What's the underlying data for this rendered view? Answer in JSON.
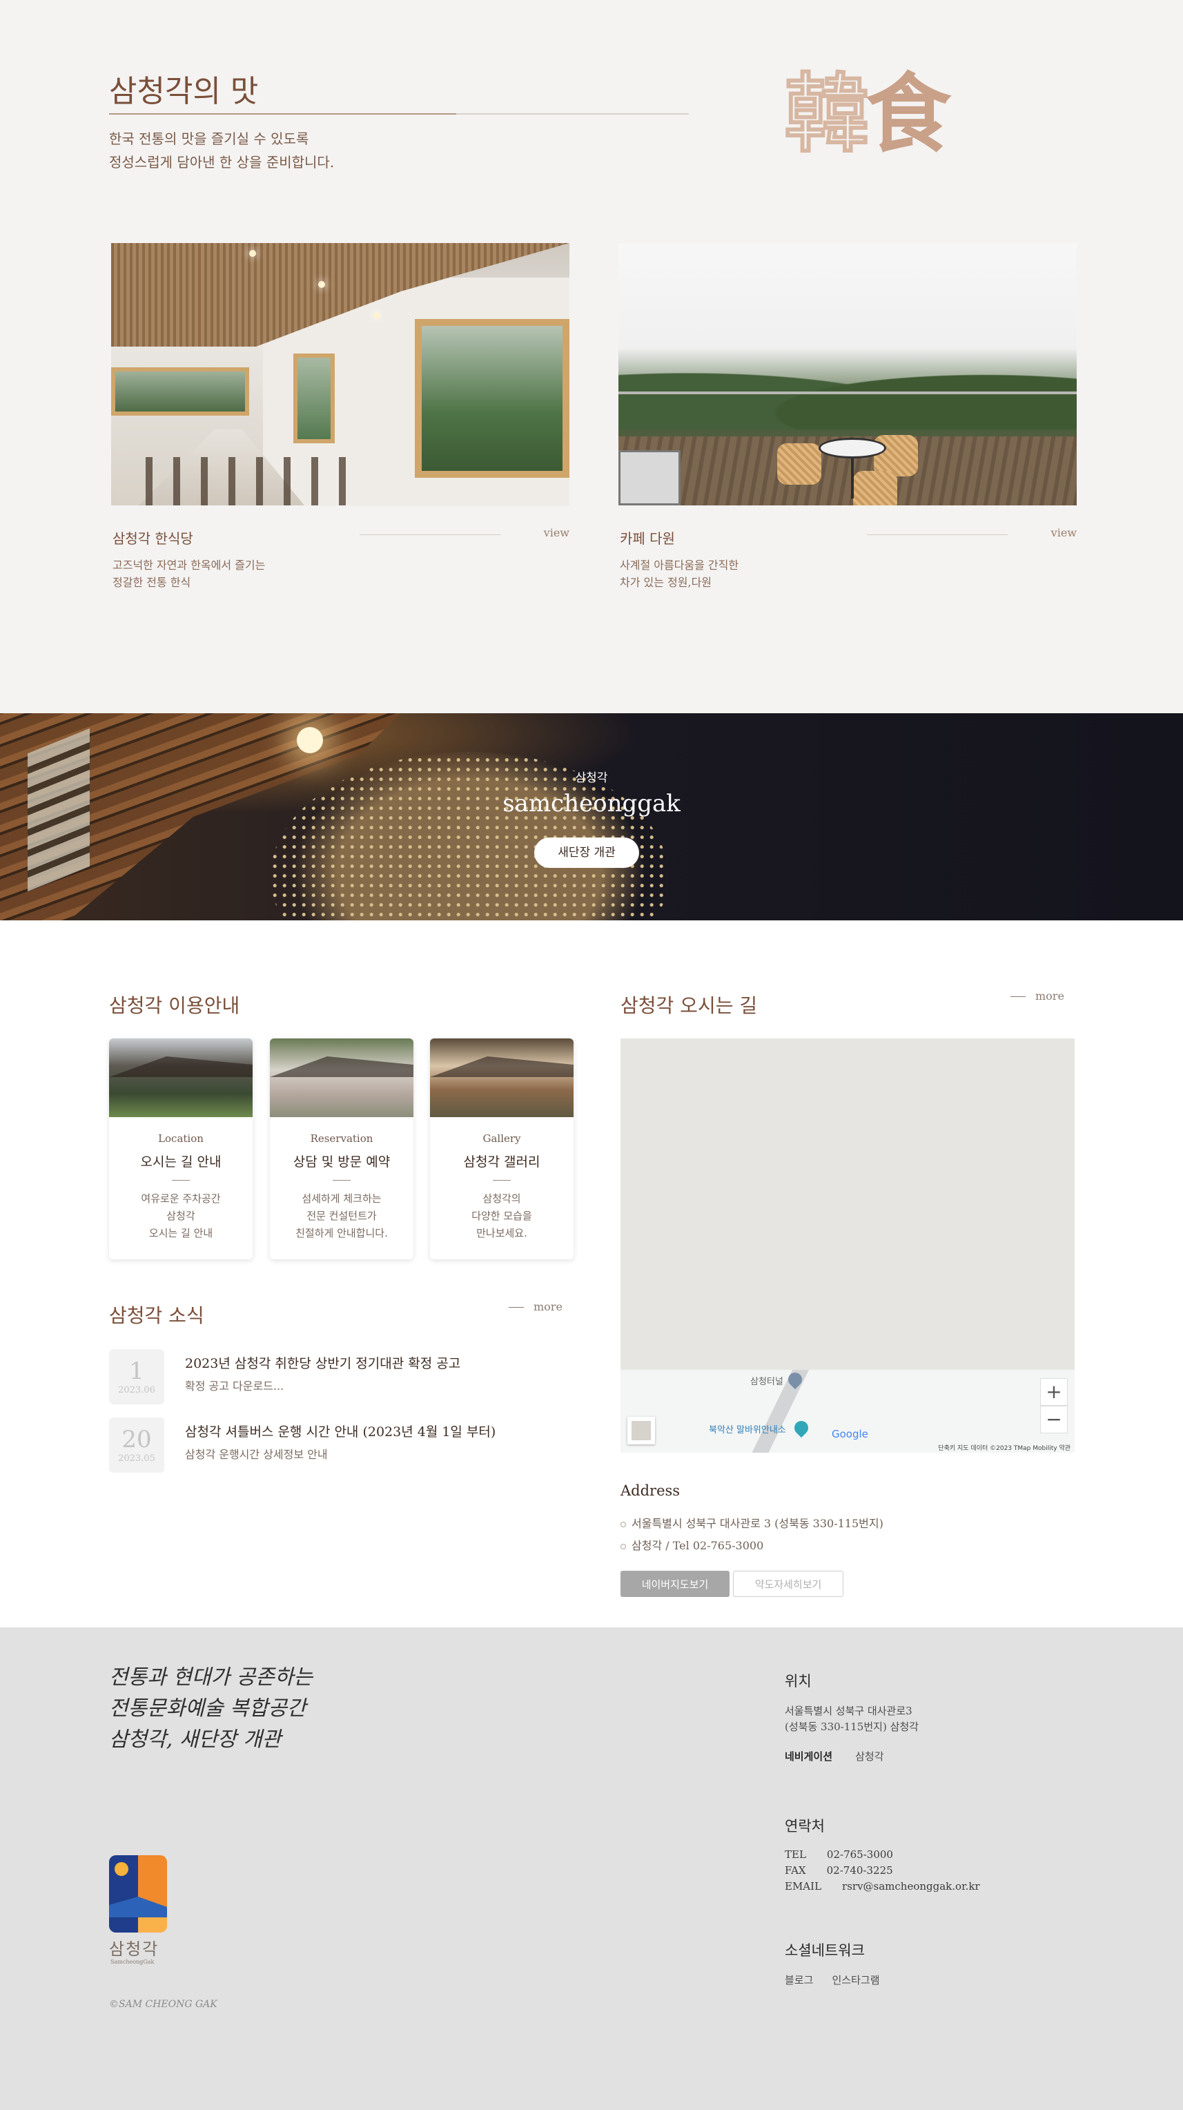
{
  "taste": {
    "title": "삼청각의 맛",
    "desc": "한국 전통의 맛을 즐기실 수 있도록\n정성스럽게 담아낸 한 상을 준비합니다.",
    "hanja_1": "韓",
    "hanja_2": "食",
    "cards": [
      {
        "title": "삼청각 한식당",
        "view": "view",
        "desc": "고즈넉한 자연과 한옥에서 즐기는\n정갈한 전통 한식"
      },
      {
        "title": "카페 다원",
        "view": "view",
        "desc": "사계절 아름다움을 간직한\n차가 있는 정원,다원"
      }
    ]
  },
  "banner": {
    "eyebrow": "삼청각",
    "title": "samcheonggak",
    "button": "새단장 개관"
  },
  "guide": {
    "title": "삼청각 이용안내",
    "cards": [
      {
        "en": "Location",
        "ko": "오시는 길 안내",
        "desc": "여유로운 주차공간\n삼청각\n오시는 길 안내"
      },
      {
        "en": "Reservation",
        "ko": "상담 및 방문 예약",
        "desc": "섬세하게 체크하는\n전문 컨설턴트가\n친절하게 안내합니다."
      },
      {
        "en": "Gallery",
        "ko": "삼청각 갤러리",
        "desc": "삼청각의\n다양한 모습을\n만나보세요."
      }
    ]
  },
  "news": {
    "title": "삼청각 소식",
    "more": "more",
    "items": [
      {
        "day": "1",
        "ym": "2023.06",
        "title": "2023년 삼청각 취한당 상반기 정기대관 확정 공고",
        "sub": "확정 공고 다운로드..."
      },
      {
        "day": "20",
        "ym": "2023.05",
        "title": "삼청각 셔틀버스 운행 시간 안내 (2023년 4월 1일 부터)",
        "sub": "삼청각 운행시간 상세정보 안내"
      }
    ]
  },
  "directions": {
    "title": "삼청각 오시는 길",
    "more": "more",
    "map": {
      "label_1": "삼청터널",
      "label_2": "북악산 말바위안내소",
      "google": "Google",
      "zoom_in": "+",
      "zoom_out": "−",
      "attribution": "단축키   지도 데이터 ©2023 TMap Mobility   약관"
    },
    "address_heading": "Address",
    "address_1": "서울특별시 성북구 대사관로 3 (성북동 330-115번지)",
    "address_2": "삼청각 / Tel 02-765-3000",
    "btn_naver": "네이버지도보기",
    "btn_detail": "약도자세히보기"
  },
  "footer": {
    "slogan": "전통과 현대가 공존하는\n전통문화예술 복합공간\n삼청각, 새단장 개관",
    "logo_name": "삼청각",
    "logo_sub": "SamcheongGak",
    "copyright": "©SAM CHEONG GAK",
    "location_h": "위치",
    "location_t": "서울특별시 성북구 대사관로3\n(성북동 330-115번지) 삼청각",
    "nav_label": "네비게이션",
    "nav_value": "삼청각",
    "contact_h": "연락처",
    "tel_k": "TEL",
    "tel_v": "02-765-3000",
    "fax_k": "FAX",
    "fax_v": "02-740-3225",
    "email_k": "EMAIL",
    "email_v": "rsrv@samcheonggak.or.kr",
    "social_h": "소셜네트워크",
    "social_1": "블로그",
    "social_2": "인스타그램"
  },
  "colors": {
    "accent_brown": "#7a4f3a",
    "bg_light": "#f4f3f2",
    "footer_bg": "#e1e1e1",
    "banner_dark": "#14141d"
  }
}
